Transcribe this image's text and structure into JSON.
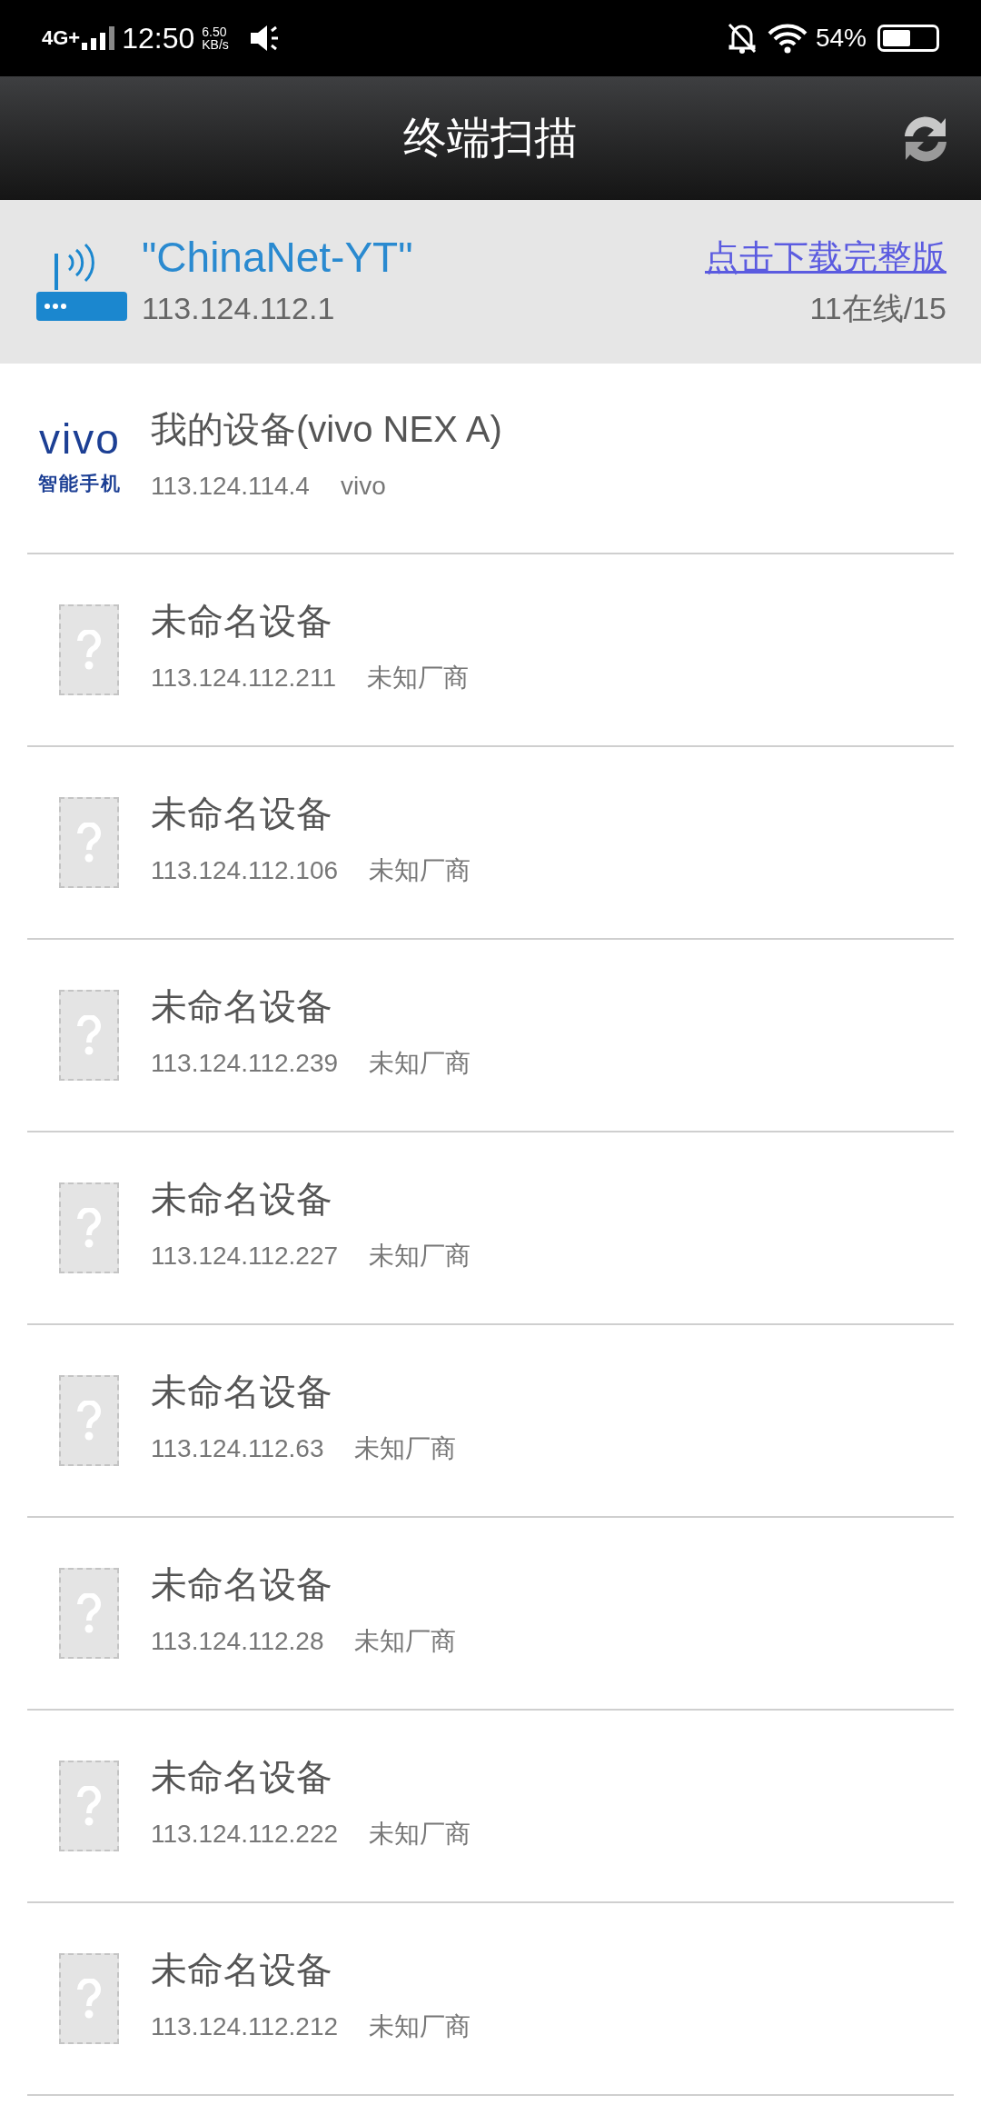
{
  "status_bar": {
    "network": "4G+",
    "time": "12:50",
    "speed_value": "6.50",
    "speed_unit": "KB/s",
    "battery": "54%"
  },
  "header": {
    "title": "终端扫描"
  },
  "network": {
    "ssid": "\"ChinaNet-YT\"",
    "ip": "113.124.112.1",
    "download_link": "点击下载完整版",
    "online": "11在线/15"
  },
  "devices": [
    {
      "kind": "brand",
      "logo_text": "vivo",
      "logo_caption": "智能手机",
      "name": "我的设备(vivo NEX A)",
      "ip": "113.124.114.4",
      "vendor": "vivo"
    },
    {
      "kind": "unknown",
      "name": "未命名设备",
      "ip": "113.124.112.211",
      "vendor": "未知厂商"
    },
    {
      "kind": "unknown",
      "name": "未命名设备",
      "ip": "113.124.112.106",
      "vendor": "未知厂商"
    },
    {
      "kind": "unknown",
      "name": "未命名设备",
      "ip": "113.124.112.239",
      "vendor": "未知厂商"
    },
    {
      "kind": "unknown",
      "name": "未命名设备",
      "ip": "113.124.112.227",
      "vendor": "未知厂商"
    },
    {
      "kind": "unknown",
      "name": "未命名设备",
      "ip": "113.124.112.63",
      "vendor": "未知厂商"
    },
    {
      "kind": "unknown",
      "name": "未命名设备",
      "ip": "113.124.112.28",
      "vendor": "未知厂商"
    },
    {
      "kind": "unknown",
      "name": "未命名设备",
      "ip": "113.124.112.222",
      "vendor": "未知厂商"
    },
    {
      "kind": "unknown",
      "name": "未命名设备",
      "ip": "113.124.112.212",
      "vendor": "未知厂商"
    }
  ]
}
